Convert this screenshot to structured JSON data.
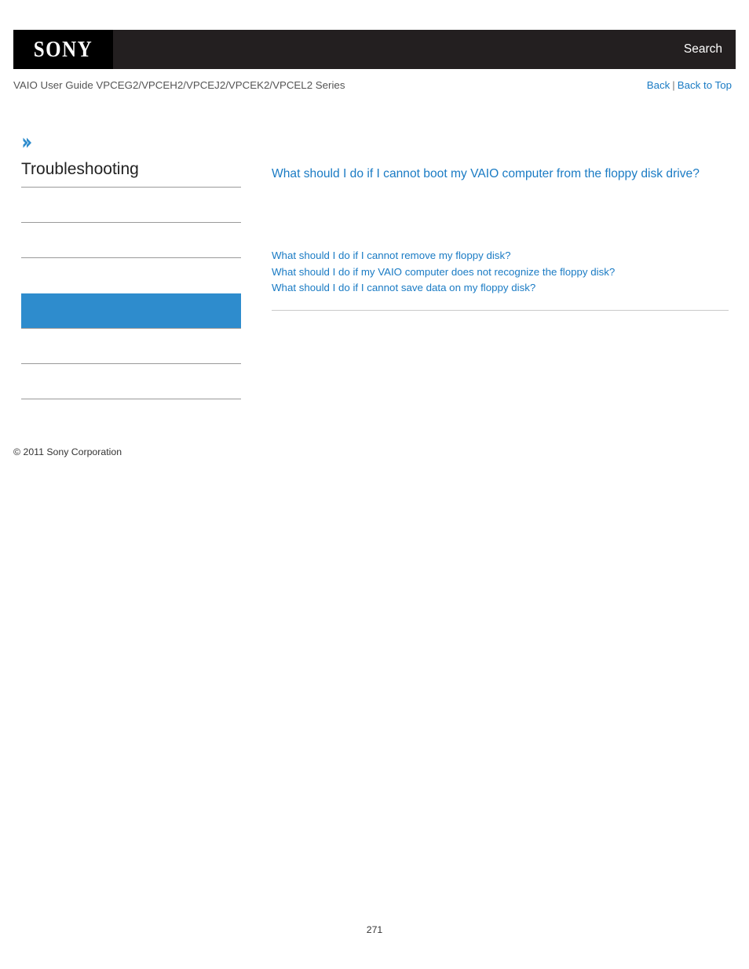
{
  "header": {
    "logo_text": "SONY",
    "search_label": "Search"
  },
  "sub_header": {
    "guide_title": "VAIO User Guide VPCEG2/VPCEH2/VPCEJ2/VPCEK2/VPCEL2 Series",
    "back_label": "Back",
    "separator": "|",
    "back_to_top_label": "Back to Top"
  },
  "sidebar": {
    "breadcrumb_icon": "chevron-right-icon",
    "title": "Troubleshooting",
    "items": [
      {
        "label": "",
        "selected": false
      },
      {
        "label": "",
        "selected": false
      },
      {
        "label": "",
        "selected": false
      },
      {
        "label": "",
        "selected": true
      },
      {
        "label": "",
        "selected": false
      },
      {
        "label": "",
        "selected": false
      }
    ],
    "copyright": "© 2011 Sony Corporation"
  },
  "main": {
    "title": "What should I do if I cannot boot my VAIO computer from the floppy disk drive?",
    "related_links": [
      "What should I do if I cannot remove my floppy disk?",
      "What should I do if my VAIO computer does not recognize the floppy disk?",
      "What should I do if I cannot save data on my floppy disk?"
    ]
  },
  "footer": {
    "page_number": "271"
  },
  "colors": {
    "header_black": "#231f20",
    "logo_black": "#000000",
    "link_blue": "#1a7bc4",
    "selected_blue": "#2e8ccd",
    "divider_gray": "#9a9a9a"
  }
}
